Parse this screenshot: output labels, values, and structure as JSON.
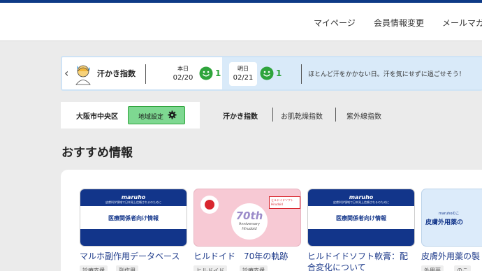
{
  "header": {
    "nav": [
      "マイページ",
      "会員情報変更",
      "メールマガ"
    ]
  },
  "index_bar": {
    "title": "汗かき指数",
    "days": [
      {
        "label": "本日",
        "date": "02/20",
        "level": "1"
      },
      {
        "label": "明日",
        "date": "02/21",
        "level": "1"
      }
    ],
    "forecast": "ほとんど汗をかかない日。汗を気にせずに過ごせそう！"
  },
  "area": {
    "name": "大阪市中央区",
    "button": "地域設定"
  },
  "tabs": [
    "汗かき指数",
    "お肌乾燥指数",
    "紫外線指数"
  ],
  "section": {
    "title": "おすすめ情報"
  },
  "cards": [
    {
      "logo": "maruho",
      "tagline": "皮膚科学領域で日本発上信頼されるのために",
      "caption": "医療関係者向け情報",
      "title": "マルホ副作用データベース",
      "tags": [
        "診療支援",
        "副作用"
      ]
    },
    {
      "anniv_num": "70th",
      "anniv_sub": "Anniversary",
      "anniv_brand": "Hirudoid",
      "pack": "ヒルドイドソフト Hirudoid",
      "title": "ヒルドイド　70年の軌跡",
      "tags": [
        "ヒルドイド",
        "診療支援"
      ]
    },
    {
      "logo": "maruho",
      "tagline": "皮膚科学領域で日本発上信頼されるのために",
      "caption": "医療関係者向け情報",
      "title_line1": "ヒルドイドソフト軟膏：配",
      "title_line2": "合変化について"
    },
    {
      "logo": "maruhoのこ",
      "caption": "皮膚外用薬の",
      "title": "皮膚外用薬の製",
      "tags": [
        "外用薬",
        "のこ"
      ]
    }
  ],
  "colors": {
    "brand_navy": "#12358a",
    "accent_green": "#2fa43c",
    "index_bg": "#d9eaf9"
  }
}
